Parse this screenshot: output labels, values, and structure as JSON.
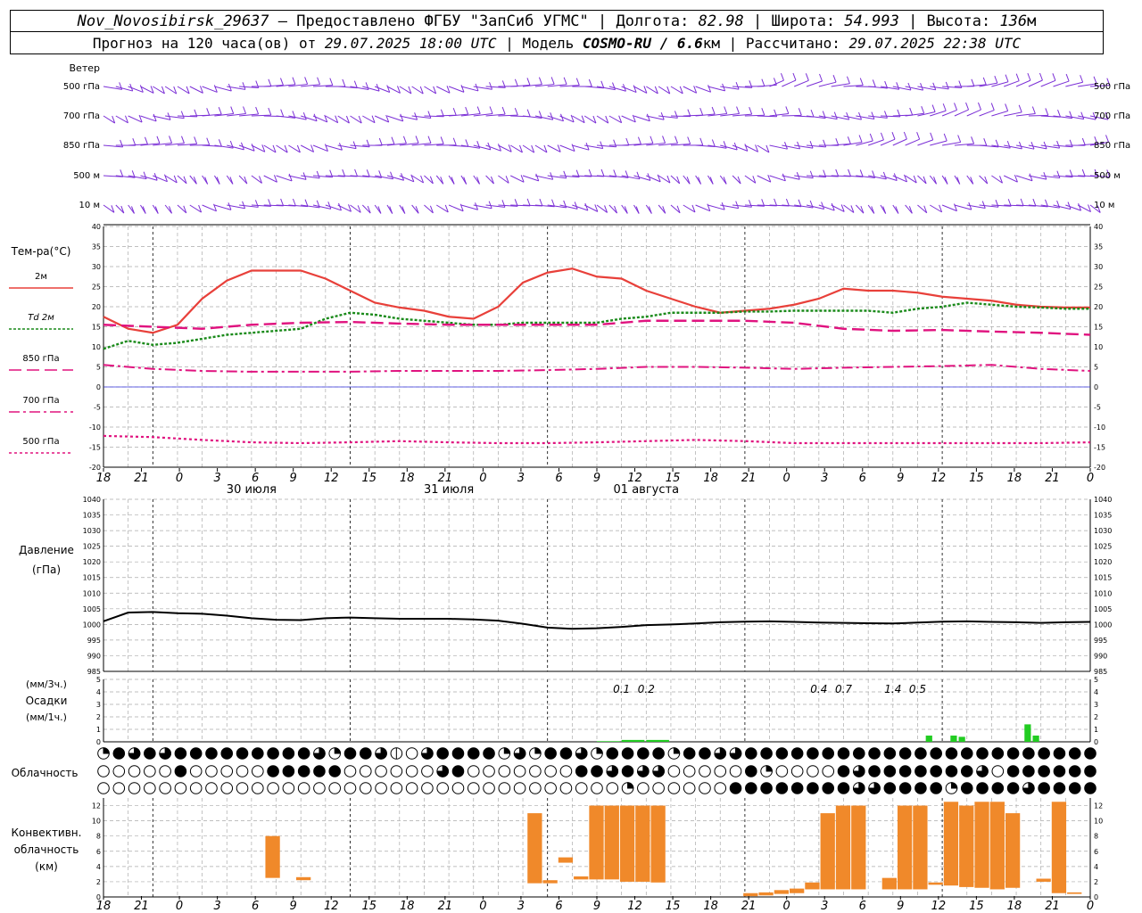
{
  "header": {
    "station": "Nov_Novosibirsk_29637",
    "dash": " – ",
    "provided": "Предоставлено ФГБУ \"ЗапСиб УГМС\"",
    "lon_label": "Долгота: ",
    "lon": "82.98",
    "lat_label": "Широта: ",
    "lat": "54.993",
    "alt_label": "Высота: ",
    "alt": "136",
    "alt_unit": "м",
    "forecast_label": "Прогноз на 120 часа(ов) от ",
    "forecast_start": "29.07.2025 18:00 UTC",
    "model_label": " | Модель ",
    "model": "COSMO-RU / 6.6",
    "model_unit": "км",
    "computed_label": " | Рассчитано: ",
    "computed": "29.07.2025 22:38 UTC"
  },
  "wind_panel": {
    "title": "Ветер",
    "levels": [
      "500 гПа",
      "700 гПа",
      "850 гПа",
      "500 м",
      "10 м"
    ],
    "color": "#7b2fd6"
  },
  "time_axis": {
    "hour_labels": [
      "18",
      "21",
      "0",
      "3",
      "6",
      "9",
      "12",
      "15",
      "18",
      "21",
      "0",
      "3",
      "6",
      "9",
      "12",
      "15",
      "18",
      "21",
      "0",
      "3",
      "6",
      "9",
      "12",
      "15",
      "18",
      "21",
      "0"
    ],
    "date_labels": [
      "30 июля",
      "31 июля",
      "01 августа"
    ]
  },
  "colors": {
    "t2m": "#e8403a",
    "td2m": "#1a8a1a",
    "t850": "#e0137f",
    "t700": "#e0137f",
    "t500": "#e0137f",
    "pressure": "#000000",
    "precip": "#22cc22",
    "convective": "#f0892a",
    "zero_line": "#3333dd"
  },
  "charts": [
    {
      "panel": "temperature",
      "title": "Тем-ра(°С)",
      "type": "line",
      "ylim": [
        -20,
        40
      ],
      "yticks": [
        -20,
        -15,
        -10,
        -5,
        0,
        5,
        10,
        15,
        20,
        25,
        30,
        35,
        40
      ],
      "series": [
        {
          "name": "2м",
          "x": [
            0,
            3,
            6,
            9,
            12,
            15,
            18,
            21,
            24,
            27,
            30,
            33,
            36,
            39,
            42,
            45,
            48,
            51,
            54,
            57,
            60,
            63,
            66,
            69,
            72,
            75,
            78,
            81,
            84,
            87,
            90,
            93,
            96,
            99,
            102,
            105,
            108,
            111,
            114,
            117,
            120
          ],
          "values": [
            17.5,
            14.5,
            13.5,
            15.5,
            22,
            26.5,
            29,
            29,
            29,
            27,
            24,
            21,
            19.8,
            19,
            17.5,
            17,
            20,
            26,
            28.5,
            29.5,
            27.5,
            27,
            24,
            22,
            20,
            18.5,
            19,
            19.5,
            20.5,
            22,
            24.5,
            24,
            24,
            23.5,
            22.5,
            22,
            21.5,
            20.5,
            20,
            19.8,
            19.8
          ]
        },
        {
          "name": "Td 2м",
          "x": [
            0,
            3,
            6,
            9,
            12,
            15,
            18,
            21,
            24,
            27,
            30,
            33,
            36,
            39,
            42,
            45,
            48,
            51,
            54,
            57,
            60,
            63,
            66,
            69,
            72,
            75,
            78,
            81,
            84,
            87,
            90,
            93,
            96,
            99,
            102,
            105,
            108,
            111,
            114,
            117,
            120
          ],
          "values": [
            9.5,
            11.5,
            10.5,
            11,
            12,
            13,
            13.5,
            14,
            14.5,
            17,
            18.5,
            18,
            17,
            16.5,
            16,
            15.5,
            15.5,
            16,
            16,
            16,
            16,
            17,
            17.5,
            18.5,
            18.5,
            18.5,
            18.8,
            18.8,
            19,
            19,
            19,
            19,
            18.5,
            19.5,
            20,
            21,
            20.5,
            20,
            19.8,
            19.5,
            19.5
          ]
        },
        {
          "name": "850 гПа",
          "x": [
            0,
            6,
            12,
            18,
            24,
            30,
            36,
            42,
            48,
            54,
            60,
            66,
            72,
            78,
            84,
            90,
            96,
            102,
            108,
            114,
            120
          ],
          "values": [
            15.5,
            15,
            14.5,
            15.5,
            16,
            16.2,
            15.8,
            15.5,
            15.5,
            15.5,
            15.5,
            16.5,
            16.5,
            16.5,
            16,
            14.5,
            14,
            14.2,
            13.8,
            13.5,
            13
          ]
        },
        {
          "name": "700 гПа",
          "x": [
            0,
            6,
            12,
            18,
            24,
            30,
            36,
            42,
            48,
            54,
            60,
            66,
            72,
            78,
            84,
            90,
            96,
            102,
            108,
            114,
            120
          ],
          "values": [
            5.5,
            4.5,
            4,
            3.8,
            3.8,
            3.8,
            4,
            4,
            4,
            4.2,
            4.5,
            5,
            5,
            4.8,
            4.5,
            4.8,
            5,
            5.2,
            5.5,
            4.5,
            4
          ]
        },
        {
          "name": "500 гПа",
          "x": [
            0,
            6,
            12,
            18,
            24,
            30,
            36,
            42,
            48,
            54,
            60,
            66,
            72,
            78,
            84,
            90,
            96,
            102,
            108,
            114,
            120
          ],
          "values": [
            -12.2,
            -12.5,
            -13.2,
            -13.8,
            -14,
            -13.8,
            -13.5,
            -13.8,
            -14,
            -14,
            -13.8,
            -13.5,
            -13.2,
            -13.5,
            -14,
            -14,
            -14,
            -14,
            -14,
            -14,
            -13.8
          ]
        }
      ]
    },
    {
      "panel": "pressure",
      "title": "Давление",
      "unit_label": "(гПа)",
      "type": "line",
      "ylim": [
        985,
        1040
      ],
      "yticks": [
        985,
        990,
        995,
        1000,
        1005,
        1010,
        1015,
        1020,
        1025,
        1030,
        1035,
        1040
      ],
      "series": [
        {
          "x": [
            0,
            3,
            6,
            9,
            12,
            15,
            18,
            21,
            24,
            27,
            30,
            33,
            36,
            39,
            42,
            45,
            48,
            51,
            54,
            57,
            60,
            63,
            66,
            69,
            72,
            75,
            78,
            81,
            84,
            87,
            90,
            93,
            96,
            99,
            102,
            105,
            108,
            111,
            114,
            117,
            120
          ],
          "values": [
            1001,
            1003.8,
            1004,
            1003.6,
            1003.4,
            1002.8,
            1002,
            1001.5,
            1001.4,
            1002,
            1002.2,
            1002,
            1001.8,
            1001.8,
            1001.8,
            1001.6,
            1001.2,
            1000.2,
            999,
            998.6,
            998.8,
            999.2,
            999.8,
            1000,
            1000.3,
            1000.7,
            1000.9,
            1001,
            1000.8,
            1000.6,
            1000.5,
            1000.4,
            1000.3,
            1000.6,
            1000.9,
            1001,
            1000.8,
            1000.7,
            1000.5,
            1000.7,
            1000.8
          ]
        }
      ]
    },
    {
      "panel": "precipitation",
      "title": "Осадки",
      "unit_top": "(мм/3ч.)",
      "unit_bottom": "(мм/1ч.)",
      "type": "bar",
      "ylim": [
        0,
        5
      ],
      "yticks": [
        0,
        1,
        2,
        3,
        4,
        5
      ],
      "bars": [
        {
          "x": 61.5,
          "w": 3,
          "value": 0.05
        },
        {
          "x": 64.5,
          "w": 3,
          "value": 0.15
        },
        {
          "x": 67.5,
          "w": 3,
          "value": 0.15
        },
        {
          "x": 100.5,
          "w": 1,
          "value": 0.5
        },
        {
          "x": 103.5,
          "w": 1,
          "value": 0.5
        },
        {
          "x": 104.5,
          "w": 1,
          "value": 0.4
        },
        {
          "x": 112.5,
          "w": 1,
          "value": 1.4
        },
        {
          "x": 113.5,
          "w": 1,
          "value": 0.5
        }
      ],
      "annotations": [
        {
          "x": 63,
          "text": "0.1"
        },
        {
          "x": 66,
          "text": "0.2"
        },
        {
          "x": 87,
          "text": "0.4"
        },
        {
          "x": 90,
          "text": "0.7"
        },
        {
          "x": 96,
          "text": "1.4"
        },
        {
          "x": 99,
          "text": "0.5"
        }
      ]
    },
    {
      "panel": "convective_cloud",
      "title_lines": [
        "Конвективн.",
        "облачность",
        "(км)"
      ],
      "type": "bar",
      "ylim": [
        0,
        13
      ],
      "yticks": [
        0,
        2,
        4,
        6,
        8,
        10,
        12
      ],
      "bars": [
        {
          "x": 11,
          "base": 2.5,
          "top": 8
        },
        {
          "x": 13,
          "base": 2.2,
          "top": 2.6
        },
        {
          "x": 28,
          "base": 1.8,
          "top": 11
        },
        {
          "x": 29,
          "base": 1.8,
          "top": 2.2
        },
        {
          "x": 30,
          "base": 4.5,
          "top": 5.2
        },
        {
          "x": 31,
          "base": 2.3,
          "top": 2.7
        },
        {
          "x": 32,
          "base": 2.3,
          "top": 12
        },
        {
          "x": 33,
          "base": 2.3,
          "top": 12
        },
        {
          "x": 34,
          "base": 2,
          "top": 12
        },
        {
          "x": 35,
          "base": 2,
          "top": 12
        },
        {
          "x": 36,
          "base": 1.9,
          "top": 12
        },
        {
          "x": 42,
          "base": 0.1,
          "top": 0.5
        },
        {
          "x": 43,
          "base": 0.2,
          "top": 0.6
        },
        {
          "x": 44,
          "base": 0.4,
          "top": 0.9
        },
        {
          "x": 45,
          "base": 0.5,
          "top": 1.1
        },
        {
          "x": 46,
          "base": 1,
          "top": 1.9
        },
        {
          "x": 47,
          "base": 1,
          "top": 11
        },
        {
          "x": 48,
          "base": 1,
          "top": 12
        },
        {
          "x": 49,
          "base": 1,
          "top": 12
        },
        {
          "x": 51,
          "base": 1,
          "top": 2.5
        },
        {
          "x": 52,
          "base": 1,
          "top": 12
        },
        {
          "x": 53,
          "base": 1,
          "top": 12
        },
        {
          "x": 54,
          "base": 1.6,
          "top": 1.9
        },
        {
          "x": 55,
          "base": 1.5,
          "top": 12.5
        },
        {
          "x": 56,
          "base": 1.3,
          "top": 12
        },
        {
          "x": 57,
          "base": 1.2,
          "top": 12.5
        },
        {
          "x": 58,
          "base": 1,
          "top": 12.5
        },
        {
          "x": 59,
          "base": 1.2,
          "top": 11
        },
        {
          "x": 61,
          "base": 2,
          "top": 2.4
        },
        {
          "x": 62,
          "base": 0.5,
          "top": 12.5
        },
        {
          "x": 63,
          "base": 0.4,
          "top": 0.6
        }
      ]
    }
  ],
  "cloud_panel": {
    "title": "Облачность",
    "rows": [
      [
        2,
        4,
        3,
        4,
        3,
        4,
        4,
        4,
        4,
        4,
        4,
        4,
        4,
        4,
        3,
        2,
        4,
        4,
        3,
        1,
        0,
        3,
        4,
        4,
        4,
        4,
        2,
        3,
        2,
        4,
        4,
        3,
        2,
        4,
        4,
        4,
        4,
        2,
        4,
        4,
        3,
        3,
        4,
        4,
        4,
        4,
        4,
        4,
        4,
        4,
        4,
        4,
        4,
        4,
        4,
        4,
        4,
        4,
        4,
        4,
        4,
        4,
        4,
        4,
        4
      ],
      [
        0,
        0,
        0,
        0,
        0,
        4,
        0,
        0,
        0,
        0,
        0,
        4,
        4,
        4,
        4,
        4,
        0,
        0,
        0,
        0,
        0,
        0,
        3,
        4,
        0,
        0,
        0,
        0,
        0,
        0,
        0,
        4,
        4,
        3,
        4,
        3,
        3,
        0,
        0,
        0,
        0,
        0,
        4,
        2,
        0,
        0,
        0,
        0,
        4,
        3,
        4,
        4,
        4,
        4,
        4,
        4,
        4,
        3,
        0,
        4,
        4,
        4,
        4,
        4,
        4
      ],
      [
        0,
        0,
        0,
        0,
        0,
        0,
        0,
        0,
        0,
        0,
        0,
        0,
        0,
        0,
        0,
        0,
        0,
        0,
        0,
        0,
        0,
        0,
        0,
        0,
        0,
        0,
        0,
        0,
        0,
        0,
        0,
        0,
        0,
        0,
        2,
        0,
        0,
        0,
        0,
        0,
        0,
        4,
        4,
        4,
        4,
        4,
        4,
        4,
        4,
        3,
        3,
        4,
        4,
        4,
        4,
        2,
        4,
        4,
        4,
        4,
        3,
        4,
        4,
        4,
        4
      ]
    ]
  }
}
